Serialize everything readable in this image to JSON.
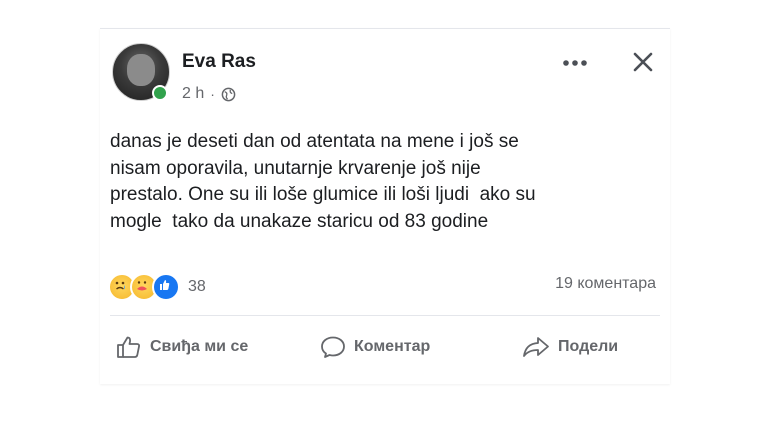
{
  "post": {
    "author_name": "Eva Ras",
    "time": "2 h",
    "separator": "·",
    "text": "danas je deseti dan od atentata na mene i još se\nnisam oporavila, unutarnje krvarenje još nije\nprestalo. One su ili loše glumice ili loši ljudi  ako su\nmogle  tako da unakaze staricu od 83 godine",
    "reaction_count": "38",
    "comment_count_label": "19 коментара",
    "reaction_types": [
      "sad-icon",
      "care-icon",
      "like-icon"
    ]
  },
  "actions": {
    "like_label": "Свиђа ми се",
    "comment_label": "Коментар",
    "share_label": "Подели"
  },
  "colors": {
    "online": "#31a24c",
    "secondary_text": "#65676b",
    "like_blue": "#1877f2"
  }
}
